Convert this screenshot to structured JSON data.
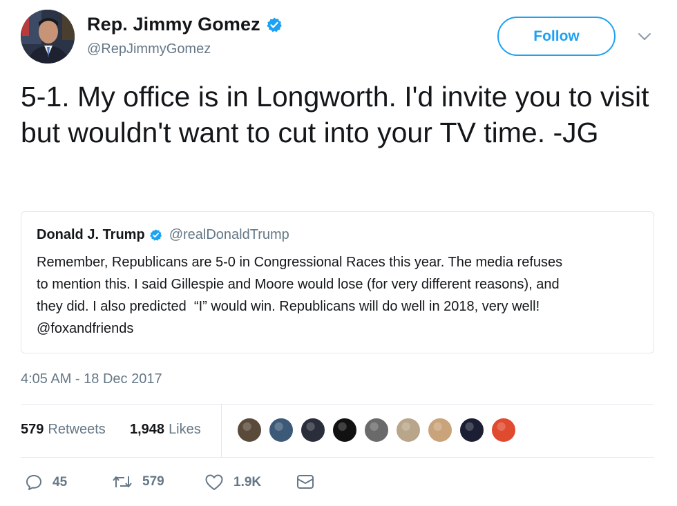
{
  "author": {
    "name": "Rep. Jimmy Gomez",
    "handle": "@RepJimmyGomez",
    "avatar_icon": "profile-photo"
  },
  "follow_label": "Follow",
  "tweet_text": "5-1. My office is in Longworth. I'd invite you to visit but wouldn't want to cut into your TV time. -JG",
  "quoted": {
    "name": "Donald J. Trump",
    "handle": "@realDonaldTrump",
    "text": "Remember, Republicans are 5-0 in Congressional Races this year. The media refuses\nto mention this. I said Gillespie and Moore would lose (for very different reasons), and\nthey did. I also predicted  “I” would win. Republicans will do well in 2018, very well!\n@foxandfriends"
  },
  "timestamp": "4:05 AM - 18 Dec 2017",
  "stats": {
    "retweets_count": "579",
    "retweets_label": "Retweets",
    "likes_count": "1,948",
    "likes_label": "Likes"
  },
  "likers": [
    {
      "name": "liker-1",
      "color": "#5a4a3a"
    },
    {
      "name": "liker-2",
      "color": "#3c5a78"
    },
    {
      "name": "liker-3",
      "color": "#2a2e3a"
    },
    {
      "name": "liker-4",
      "color": "#111111"
    },
    {
      "name": "liker-5",
      "color": "#6a6a6a"
    },
    {
      "name": "liker-6",
      "color": "#b8a58a"
    },
    {
      "name": "liker-7",
      "color": "#c9a37a"
    },
    {
      "name": "liker-8",
      "color": "#1c1f33"
    },
    {
      "name": "liker-9",
      "color": "#e04a2f"
    }
  ],
  "actions": {
    "reply_count": "45",
    "retweet_count": "579",
    "like_count": "1.9K"
  },
  "colors": {
    "accent": "#1da1f2",
    "muted": "#657786",
    "border": "#e1e8ed"
  }
}
